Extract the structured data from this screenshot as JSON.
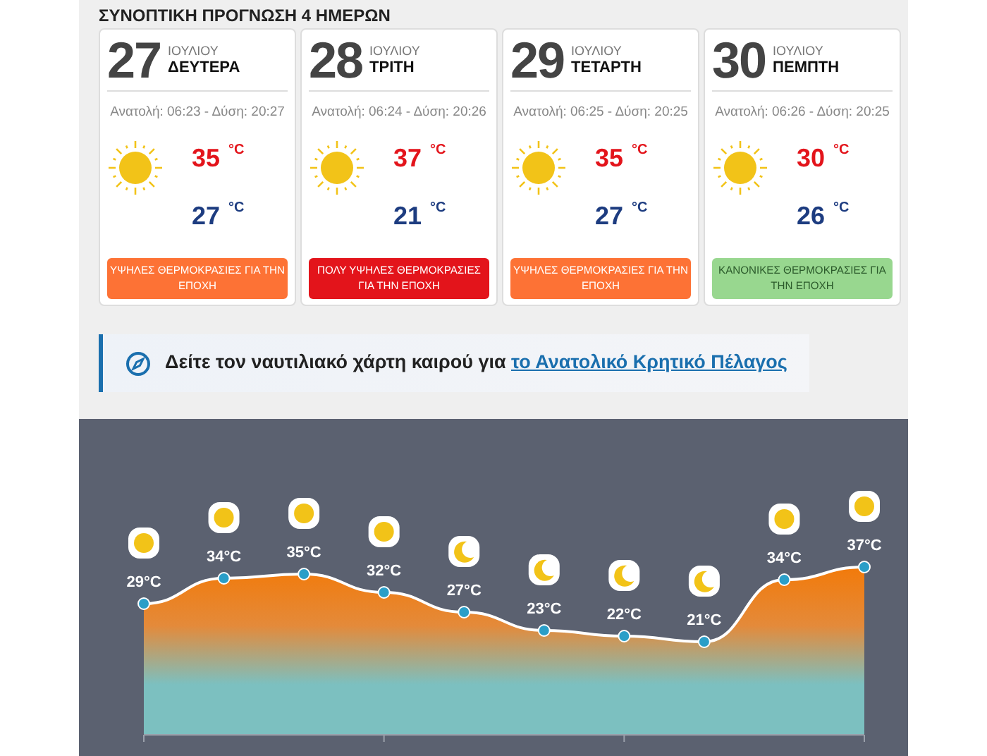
{
  "section_title": "ΣΥΝΟΠΤΙΚΗ ΠΡΟΓΝΩΣΗ 4 ΗΜΕΡΩΝ",
  "days": [
    {
      "date": "27",
      "month": "ΙΟΥΛΙΟΥ",
      "weekday": "ΔΕΥΤΕΡΑ",
      "sun_times": "Ανατολή: 06:23 - Δύση: 20:27",
      "high": "35",
      "low": "27",
      "unit_high": "°C",
      "unit_low": "°C",
      "alert": {
        "text": "ΥΨΗΛΕΣ ΘΕΡΜΟΚΡΑΣΙΕΣ ΓΙΑ ΤΗΝ ΕΠΟΧΗ",
        "color": "#fd7235"
      }
    },
    {
      "date": "28",
      "month": "ΙΟΥΛΙΟΥ",
      "weekday": "ΤΡΙΤΗ",
      "sun_times": "Ανατολή: 06:24 - Δύση: 20:26",
      "high": "37",
      "low": "21",
      "unit_high": "°C",
      "unit_low": "°C",
      "alert": {
        "text": "ΠΟΛΥ ΥΨΗΛΕΣ ΘΕΡΜΟΚΡΑΣΙΕΣ ΓΙΑ ΤΗΝ ΕΠΟΧΗ",
        "color": "#e3141b"
      }
    },
    {
      "date": "29",
      "month": "ΙΟΥΛΙΟΥ",
      "weekday": "ΤΕΤΑΡΤΗ",
      "sun_times": "Ανατολή: 06:25 - Δύση: 20:25",
      "high": "35",
      "low": "27",
      "unit_high": "°C",
      "unit_low": "°C",
      "alert": {
        "text": "ΥΨΗΛΕΣ ΘΕΡΜΟΚΡΑΣΙΕΣ ΓΙΑ ΤΗΝ ΕΠΟΧΗ",
        "color": "#fd7235"
      }
    },
    {
      "date": "30",
      "month": "ΙΟΥΛΙΟΥ",
      "weekday": "ΠΕΜΠΤΗ",
      "sun_times": "Ανατολή: 06:26 - Δύση: 20:25",
      "high": "30",
      "low": "26",
      "unit_high": "°C",
      "unit_low": "°C",
      "alert": {
        "text": "ΚΑΝΟΝΙΚΕΣ ΘΕΡΜΟΚΡΑΣΙΕΣ ΓΙΑ ΤΗΝ ΕΠΟΧΗ",
        "color": "#98d78f"
      }
    }
  ],
  "banner": {
    "text": "Δείτε τον ναυτιλιακό χάρτη καιρού για",
    "link": "το Ανατολικό Κρητικό Πέλαγος"
  },
  "hourly": [
    {
      "kind": "sun",
      "temperature": "29°C"
    },
    {
      "kind": "sun",
      "temperature": "34°C"
    },
    {
      "kind": "sun",
      "temperature": "35°C"
    },
    {
      "kind": "sun",
      "temperature": "32°C"
    },
    {
      "kind": "moon",
      "temperature": "27°C"
    },
    {
      "kind": "moon",
      "temperature": "23°C"
    },
    {
      "kind": "moon",
      "temperature": "22°C"
    },
    {
      "kind": "moon",
      "temperature": "21°C"
    },
    {
      "kind": "sun",
      "temperature": "34°C"
    },
    {
      "kind": "sun",
      "temperature": "37°C"
    }
  ]
}
